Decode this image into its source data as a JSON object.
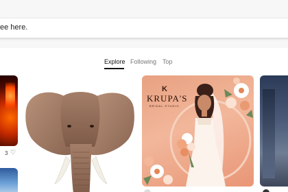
{
  "search": {
    "placeholder_text": "ee here."
  },
  "tabs": [
    {
      "label": "Explore",
      "active": true
    },
    {
      "label": "Following",
      "active": false
    },
    {
      "label": "Top",
      "active": false
    }
  ],
  "feed": {
    "left_card_like_count": "3",
    "krupa_card": {
      "logo": "K",
      "title": "KRUPA'S",
      "subtitle": "BRIDAL STUDIO"
    }
  },
  "colors": {
    "active_tab": "#111111",
    "inactive_tab": "#777777",
    "top_band": "#f7f7f8"
  }
}
